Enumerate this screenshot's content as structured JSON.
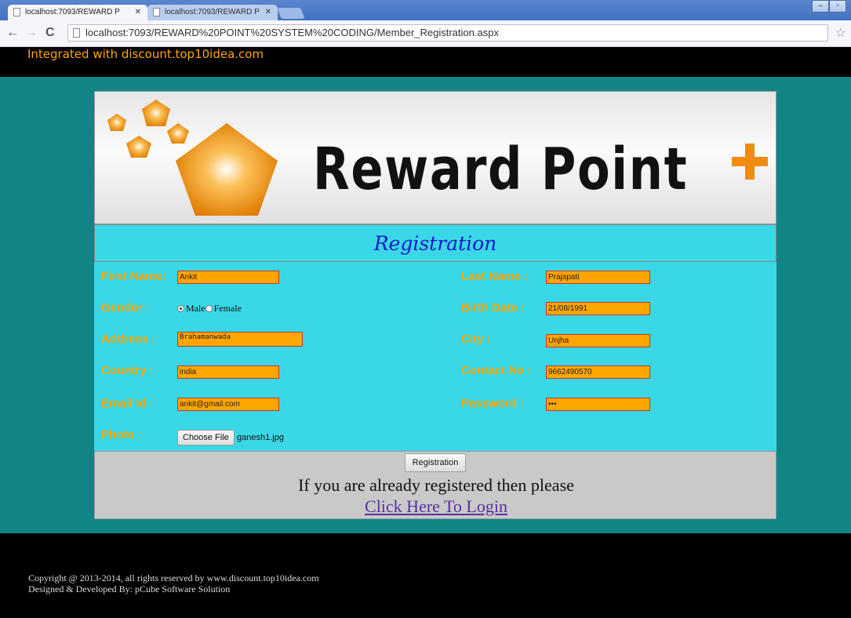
{
  "browser": {
    "tabs": [
      {
        "title": "localhost:7093/REWARD P"
      },
      {
        "title": "localhost:7093/REWARD P"
      }
    ],
    "url": "localhost:7093/REWARD%20POINT%20SYSTEM%20CODING/Member_Registration.aspx"
  },
  "page": {
    "integrated_text": "Integrated with discount.top10idea.com",
    "brand_text": "Reward Point",
    "form_title": "Registration",
    "fields": {
      "first_name": {
        "label": "First Name:",
        "value": "Ankit"
      },
      "last_name": {
        "label": "Last Name :",
        "value": "Prajapati"
      },
      "gender": {
        "label": "Gender :",
        "options": [
          "Male",
          "Female"
        ],
        "selected": "Male"
      },
      "birth_date": {
        "label": "Birth Date :",
        "value": "21/08/1991"
      },
      "address": {
        "label": "Address :",
        "value": "Brahamanwada"
      },
      "city": {
        "label": "City :",
        "value": "Unjha"
      },
      "country": {
        "label": "Country :",
        "value": "india"
      },
      "contact_no": {
        "label": "Contact No :",
        "value": "9662490570"
      },
      "email": {
        "label": "Email Id :",
        "value": "ankit@gmail.com"
      },
      "password": {
        "label": "Password :",
        "value": "•••"
      },
      "photo": {
        "label": "Photo :",
        "button": "Choose File",
        "filename": "ganesh1.jpg"
      }
    },
    "register_button": "Registration",
    "already_text": "If you are already registered then please",
    "login_link": "Click Here To Login",
    "copyright_line1": "Copyright @ 2013-2014, all rights reserved by www.discount.top10idea.com",
    "copyright_line2": "Designed & Developed By: pCube Software Solution"
  },
  "colors": {
    "teal_bg": "#0f8585",
    "form_bg": "#3ad7e6",
    "label_orange": "#ffa500",
    "title_blue": "#1919c8",
    "brand_orange": "#f08c10"
  }
}
